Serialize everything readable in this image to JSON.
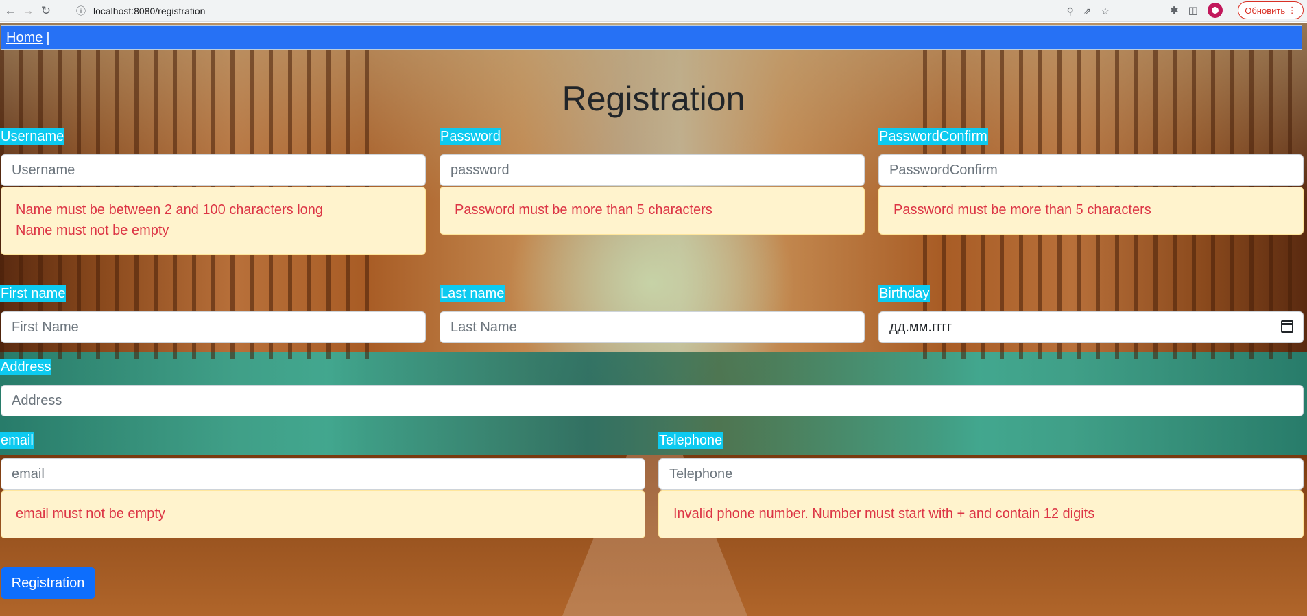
{
  "browser": {
    "url": "localhost:8080/registration",
    "update_label": "Обновить",
    "icons": [
      "back-icon",
      "forward-icon",
      "reload-icon",
      "info-icon",
      "zoom-icon",
      "share-icon",
      "star-icon",
      "extensions-icon",
      "side-panel-icon",
      "profile-avatar",
      "menu-icon"
    ]
  },
  "navbar": {
    "home": "Home",
    "separator": "|"
  },
  "title": "Registration",
  "form": {
    "username": {
      "label": "Username",
      "placeholder": "Username",
      "errors": [
        "Name must be between 2 and 100 characters long",
        "Name must not be empty"
      ]
    },
    "password": {
      "label": "Password",
      "placeholder": "password",
      "errors": [
        "Password must be more than 5 characters"
      ]
    },
    "password_confirm": {
      "label": "PasswordConfirm",
      "placeholder": "PasswordConfirm",
      "errors": [
        "Password must be more than 5 characters"
      ]
    },
    "first_name": {
      "label": "First name",
      "placeholder": "First Name"
    },
    "last_name": {
      "label": "Last name",
      "placeholder": "Last Name"
    },
    "birthday": {
      "label": "Birthday",
      "value": "дд.мм.гггг"
    },
    "address": {
      "label": "Address",
      "placeholder": "Address"
    },
    "email": {
      "label": "email",
      "placeholder": "email",
      "errors": [
        "email must not be empty"
      ]
    },
    "telephone": {
      "label": "Telephone",
      "placeholder": "Telephone",
      "errors": [
        "Invalid phone number. Number must start with + and contain 12 digits"
      ]
    },
    "submit_label": "Registration"
  },
  "colors": {
    "navbar": "#2671f5",
    "label_bg": "#0dcaf0",
    "error_bg": "#fff3cd",
    "error_text": "#dc3545",
    "button": "#0d6efd"
  }
}
